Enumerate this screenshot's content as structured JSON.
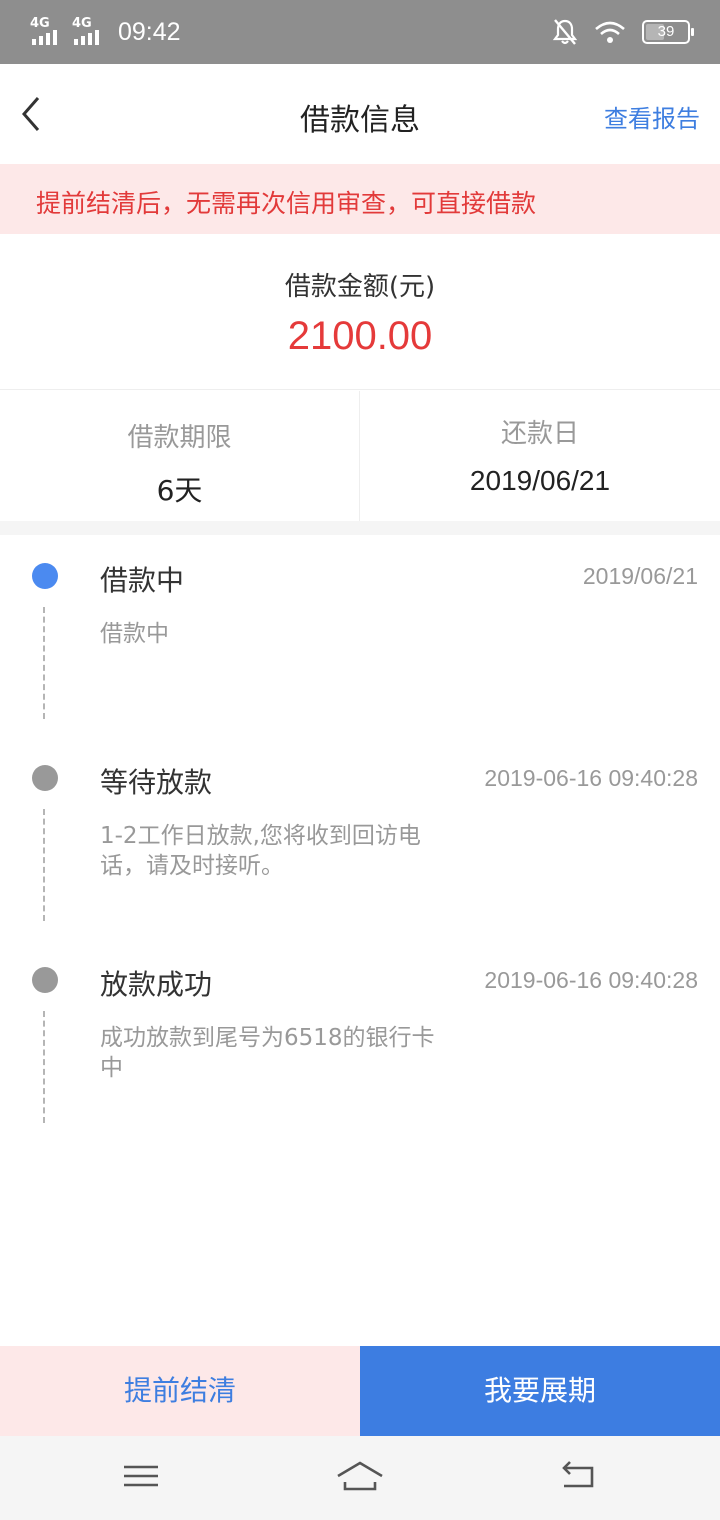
{
  "status_bar": {
    "network_1": "4G",
    "network_2": "4G",
    "time": "09:42",
    "battery": "39"
  },
  "header": {
    "title": "借款信息",
    "report_link": "查看报告"
  },
  "notice": {
    "text": "提前结清后，无需再次信用审查，可直接借款"
  },
  "amount": {
    "label": "借款金额(元)",
    "value": "2100.00"
  },
  "info": {
    "term_label": "借款期限",
    "term_value": "6天",
    "due_label": "还款日",
    "due_value": "2019/06/21"
  },
  "timeline": [
    {
      "title": "借款中",
      "time": "2019/06/21",
      "desc": "借款中",
      "active": true
    },
    {
      "title": "等待放款",
      "time": "2019-06-16 09:40:28",
      "desc": "1-2工作日放款,您将收到回访电话，请及时接听。",
      "active": false
    },
    {
      "title": "放款成功",
      "time": "2019-06-16 09:40:28",
      "desc": "成功放款到尾号为6518的银行卡中",
      "active": false
    }
  ],
  "buttons": {
    "early_payoff": "提前结清",
    "extend": "我要展期"
  },
  "colors": {
    "accent_blue": "#3d7de1",
    "alert_red": "#e53a3a",
    "notice_bg": "#fde8e8",
    "active_dot": "#4b8af0"
  }
}
